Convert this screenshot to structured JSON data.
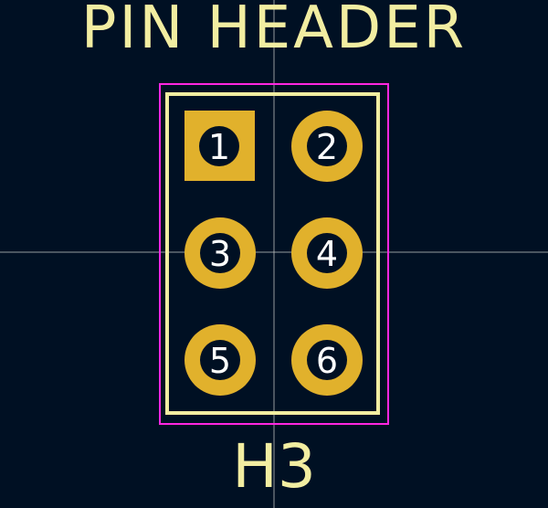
{
  "footprint": {
    "title": "PIN HEADER",
    "reference": "H3",
    "pads": [
      {
        "number": "1",
        "shape": "square"
      },
      {
        "number": "2",
        "shape": "round"
      },
      {
        "number": "3",
        "shape": "round"
      },
      {
        "number": "4",
        "shape": "round"
      },
      {
        "number": "5",
        "shape": "round"
      },
      {
        "number": "6",
        "shape": "round"
      }
    ]
  },
  "colors": {
    "background": "#001023",
    "silkscreen": "#f2eda1",
    "courtyard": "#ff26e2",
    "pad_copper": "#e1b12c",
    "drill_hole": "#001023",
    "pad_text": "#ffffff",
    "crosshair": "#c8c8c8"
  }
}
